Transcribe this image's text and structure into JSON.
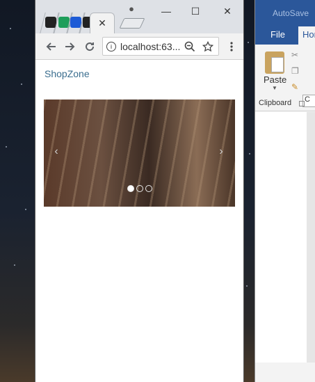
{
  "browser": {
    "tab": {
      "close_glyph": "✕"
    },
    "controls": {
      "minimize": "—",
      "maximize": "☐",
      "close": "✕"
    },
    "toolbar": {
      "url": "localhost:63...",
      "icons": [
        "back-arrow-icon",
        "forward-arrow-icon",
        "reload-icon",
        "info-icon",
        "zoom-out-icon",
        "star-icon",
        "menu-dots-icon"
      ]
    }
  },
  "page": {
    "brand": "ShopZone",
    "carousel": {
      "prev": "‹",
      "next": "›",
      "slides": 3,
      "active_slide": 1
    }
  },
  "word": {
    "title": "AutoSave",
    "tabs": {
      "file": "File",
      "home": "Hon"
    },
    "ribbon": {
      "paste": "Paste",
      "group": "Clipboard",
      "field": "C"
    }
  }
}
